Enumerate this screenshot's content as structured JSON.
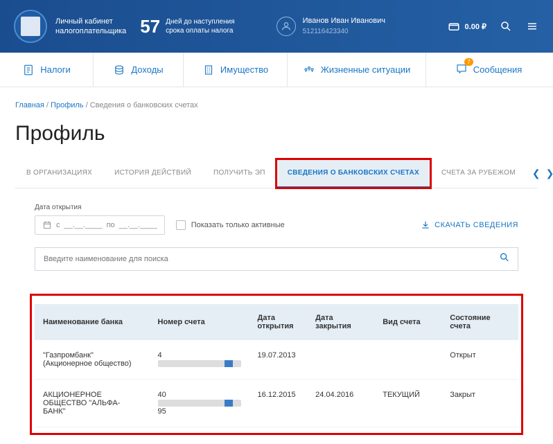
{
  "header": {
    "title": "Личный кабинет\nналогоплательщика",
    "days_number": "57",
    "days_text": "Дней до наступления\nсрока оплаты налога",
    "user_name": "Иванов Иван Иванович",
    "user_id": "512116423340",
    "balance": "0.00 ₽"
  },
  "nav": [
    {
      "label": "Налоги"
    },
    {
      "label": "Доходы"
    },
    {
      "label": "Имущество"
    },
    {
      "label": "Жизненные ситуации"
    },
    {
      "label": "Сообщения",
      "badge": "7"
    }
  ],
  "breadcrumb": {
    "root": "Главная",
    "mid": "Профиль",
    "current": "Сведения о банковских счетах"
  },
  "page_title": "Профиль",
  "tabs": [
    {
      "label": "В ОРГАНИЗАЦИЯХ"
    },
    {
      "label": "ИСТОРИЯ ДЕЙСТВИЙ"
    },
    {
      "label": "ПОЛУЧИТЬ ЭП"
    },
    {
      "label": "СВЕДЕНИЯ О БАНКОВСКИХ СЧЕТАХ",
      "active": true
    },
    {
      "label": "СЧЕТА ЗА РУБЕЖОМ"
    }
  ],
  "filter": {
    "date_label": "Дата открытия",
    "date_from_prefix": "с",
    "date_from_mask": "__.__.____",
    "date_to_prefix": "по",
    "date_to_mask": "__.__.____",
    "active_only": "Показать только активные",
    "download": "СКАЧАТЬ СВЕДЕНИЯ",
    "search_placeholder": "Введите наименование для поиска"
  },
  "table": {
    "headers": [
      "Наименование банка",
      "Номер счета",
      "Дата открытия",
      "Дата закрытия",
      "Вид счета",
      "Состояние счета"
    ],
    "rows": [
      {
        "bank": "\"Газпромбанк\" (Акционерное общество)",
        "acc_prefix": "4",
        "acc_suffix": "",
        "open": "19.07.2013",
        "close": "",
        "type": "",
        "state": "Открыт"
      },
      {
        "bank": "АКЦИОНЕРНОЕ ОБЩЕСТВО \"АЛЬФА-БАНК\"",
        "acc_prefix": "40",
        "acc_suffix": "95",
        "open": "16.12.2015",
        "close": "24.04.2016",
        "type": "ТЕКУЩИЙ",
        "state": "Закрыт"
      }
    ]
  }
}
